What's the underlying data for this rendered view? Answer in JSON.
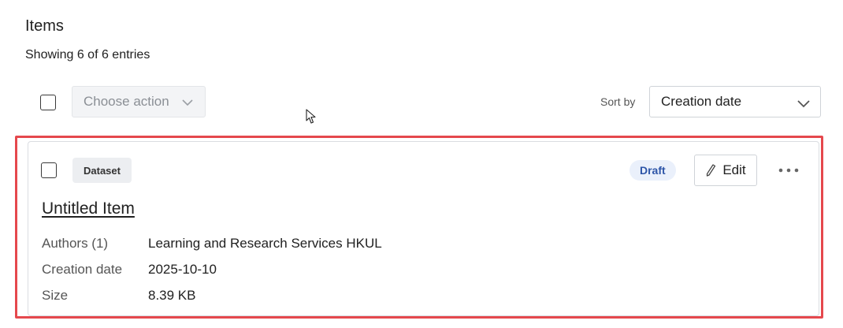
{
  "header": {
    "title": "Items",
    "entries_text": "Showing 6 of 6 entries"
  },
  "toolbar": {
    "action_placeholder": "Choose action",
    "sort_label": "Sort by",
    "sort_value": "Creation date"
  },
  "item": {
    "type": "Dataset",
    "status": "Draft",
    "edit_label": "Edit",
    "title": "Untitled Item",
    "metadata": [
      {
        "label": "Authors (1)",
        "value": "Learning and Research Services HKUL"
      },
      {
        "label": "Creation date",
        "value": "2025-10-10"
      },
      {
        "label": "Size",
        "value": "8.39 KB"
      }
    ]
  },
  "colors": {
    "highlight_border": "#e5484d",
    "status_text": "#2d55a8",
    "status_bg": "#eaf0fb"
  },
  "icons": [
    "chevron-down-icon",
    "pencil-icon",
    "more-horizontal-icon",
    "mouse-cursor-icon"
  ]
}
